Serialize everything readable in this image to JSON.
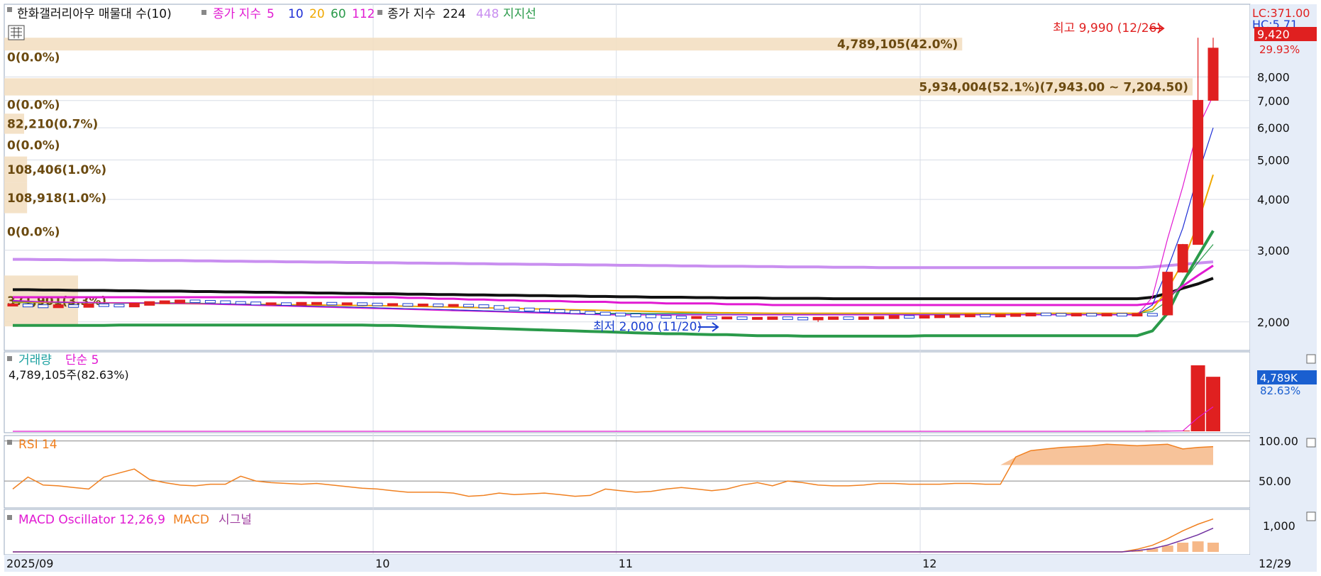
{
  "legend": {
    "title": "한화갤러리아우 매물대 수(10)",
    "ma_prefix": "종가 지수",
    "ma_periods": [
      {
        "label": "5",
        "color": "#e11ad2"
      },
      {
        "label": "10",
        "color": "#1f2fd6"
      },
      {
        "label": "20",
        "color": "#f0a800"
      },
      {
        "label": "60",
        "color": "#2a9a4a"
      },
      {
        "label": "112",
        "color": "#e11ad2"
      }
    ],
    "ma_prefix2": "종가 지수",
    "ma_224": "224",
    "ma_448": "448",
    "support_line": "지지선"
  },
  "price_panel": {
    "high_label": "최고 9,990 (12/26)",
    "low_label": "최저 2,000 (11/20)",
    "lc_label": "LC:371.00",
    "hc_label": "HC:5.71",
    "current_price": "9,420",
    "change_pct": "29.93%",
    "y_ticks": [
      "8,000",
      "7,000",
      "6,000",
      "5,000",
      "4,000",
      "3,000",
      "2,000"
    ],
    "volume_profile": [
      {
        "label": "4,789,105(42.0%)",
        "price_from": 9990,
        "price_to": 9300,
        "pct": 42.0
      },
      {
        "label": "0(0.0%)",
        "price_from": 9300,
        "price_to": 8600,
        "pct": 0.0
      },
      {
        "label": "5,934,004(52.1%)(7,943.00 ~ 7,204.50)",
        "price_from": 7943,
        "price_to": 7204.5,
        "pct": 52.1
      },
      {
        "label": "0(0.0%)",
        "price_from": 7204.5,
        "price_to": 6500,
        "pct": 0.0
      },
      {
        "label": "82,210(0.7%)",
        "price_from": 6500,
        "price_to": 5800,
        "pct": 0.7
      },
      {
        "label": "0(0.0%)",
        "price_from": 5800,
        "price_to": 5100,
        "pct": 0.0
      },
      {
        "label": "108,406(1.0%)",
        "price_from": 5100,
        "price_to": 4400,
        "pct": 1.0
      },
      {
        "label": "108,918(1.0%)",
        "price_from": 4400,
        "price_to": 3700,
        "pct": 1.0
      },
      {
        "label": "0(0.0%)",
        "price_from": 3700,
        "price_to": 3000,
        "pct": 0.0
      },
      {
        "label": "371,901(3.3%)",
        "price_from": 2600,
        "price_to": 1950,
        "pct": 3.3
      }
    ]
  },
  "volume_panel": {
    "title": "거래량",
    "ma_label": "단순 5",
    "value_label": "4,789,105주(82.63%)",
    "right_value": "4,789K",
    "right_pct": "82.63%"
  },
  "rsi_panel": {
    "title": "RSI 14",
    "ticks": [
      "100.00",
      "50.00"
    ]
  },
  "macd_panel": {
    "title": "MACD Oscillator 12,26,9",
    "macd_label": "MACD",
    "signal_label": "시그널",
    "tick": "1,000"
  },
  "x_axis": {
    "labels": [
      "2025/09",
      "10",
      "11",
      "12"
    ],
    "end_label": "12/29"
  },
  "colors": {
    "up": "#e02020",
    "down": "#1a3fd0",
    "volume_profile_bg": "#f3dfc2",
    "volume_profile_text": "#6b4a10",
    "ma224": "#111111",
    "ma448": "#c98ff0",
    "support": "#2a9a4a",
    "rsi": "#f08020",
    "axis_bg": "#e6edf8"
  },
  "chart_data": {
    "type": "candlestick",
    "title": "한화갤러리아우",
    "x": [
      "09/01",
      "09/02",
      "09/03",
      "09/04",
      "09/05",
      "09/08",
      "09/09",
      "09/10",
      "09/11",
      "09/12",
      "09/15",
      "09/16",
      "09/17",
      "09/18",
      "09/19",
      "09/22",
      "09/23",
      "09/24",
      "09/25",
      "09/26",
      "09/29",
      "09/30",
      "10/01",
      "10/02",
      "10/10",
      "10/13",
      "10/14",
      "10/15",
      "10/16",
      "10/17",
      "10/20",
      "10/21",
      "10/22",
      "10/23",
      "10/24",
      "10/27",
      "10/28",
      "10/29",
      "10/30",
      "10/31",
      "11/03",
      "11/04",
      "11/05",
      "11/06",
      "11/07",
      "11/10",
      "11/11",
      "11/12",
      "11/13",
      "11/14",
      "11/17",
      "11/18",
      "11/19",
      "11/20",
      "11/21",
      "11/24",
      "11/25",
      "11/26",
      "11/27",
      "11/28",
      "12/01",
      "12/02",
      "12/03",
      "12/04",
      "12/05",
      "12/08",
      "12/09",
      "12/10",
      "12/11",
      "12/12",
      "12/15",
      "12/16",
      "12/17",
      "12/18",
      "12/19",
      "12/22",
      "12/23",
      "12/24",
      "12/26",
      "12/29"
    ],
    "close": [
      2200,
      2190,
      2180,
      2190,
      2185,
      2200,
      2195,
      2190,
      2210,
      2230,
      2240,
      2250,
      2245,
      2240,
      2230,
      2225,
      2215,
      2215,
      2210,
      2220,
      2220,
      2215,
      2215,
      2210,
      2205,
      2205,
      2200,
      2200,
      2195,
      2195,
      2190,
      2180,
      2160,
      2150,
      2140,
      2130,
      2120,
      2110,
      2100,
      2090,
      2080,
      2070,
      2060,
      2055,
      2050,
      2050,
      2045,
      2045,
      2040,
      2040,
      2045,
      2040,
      2035,
      2040,
      2045,
      2040,
      2045,
      2050,
      2060,
      2055,
      2060,
      2065,
      2070,
      2075,
      2070,
      2075,
      2080,
      2090,
      2085,
      2080,
      2085,
      2080,
      2085,
      2080,
      2085,
      2080,
      2650,
      3100,
      7010,
      9420
    ],
    "high": 9990,
    "low": 2000,
    "high_date": "12/26",
    "low_date": "11/20",
    "ma5": [
      2260,
      2250,
      2240,
      2240,
      2235,
      2235,
      2230,
      2230,
      2230,
      2225,
      2225,
      2220,
      2215,
      2210,
      2205,
      2200,
      2195,
      2190,
      2185,
      2180,
      2175,
      2170,
      2165,
      2160,
      2155,
      2150,
      2145,
      2140,
      2135,
      2130,
      2125,
      2120,
      2115,
      2110,
      2105,
      2100,
      2095,
      2090,
      2085,
      2080,
      2080,
      2080,
      2080,
      2080,
      2080,
      2080,
      2080,
      2080,
      2080,
      2080,
      2080,
      2080,
      2080,
      2080,
      2080,
      2080,
      2080,
      2080,
      2080,
      2080,
      2080,
      2080,
      2080,
      2080,
      2080,
      2080,
      2080,
      2080,
      2080,
      2080,
      2080,
      2080,
      2080,
      2080,
      2080,
      2300,
      3200,
      4300,
      6000,
      7200
    ],
    "ma10": [
      2250,
      2245,
      2240,
      2235,
      2230,
      2230,
      2228,
      2226,
      2224,
      2222,
      2220,
      2218,
      2216,
      2214,
      2212,
      2210,
      2205,
      2200,
      2195,
      2190,
      2185,
      2180,
      2175,
      2170,
      2165,
      2160,
      2155,
      2150,
      2145,
      2140,
      2135,
      2130,
      2125,
      2120,
      2115,
      2110,
      2105,
      2100,
      2095,
      2090,
      2085,
      2085,
      2085,
      2085,
      2085,
      2085,
      2085,
      2085,
      2085,
      2085,
      2085,
      2085,
      2085,
      2085,
      2085,
      2085,
      2085,
      2085,
      2085,
      2085,
      2085,
      2085,
      2085,
      2085,
      2085,
      2085,
      2085,
      2085,
      2085,
      2085,
      2085,
      2085,
      2085,
      2085,
      2085,
      2200,
      2700,
      3400,
      4600,
      6000
    ],
    "ma20": [
      2240,
      2238,
      2236,
      2234,
      2232,
      2230,
      2228,
      2226,
      2224,
      2222,
      2220,
      2218,
      2216,
      2214,
      2212,
      2210,
      2208,
      2206,
      2204,
      2202,
      2200,
      2198,
      2196,
      2194,
      2192,
      2190,
      2186,
      2182,
      2178,
      2174,
      2170,
      2166,
      2162,
      2158,
      2154,
      2150,
      2146,
      2142,
      2138,
      2134,
      2130,
      2126,
      2122,
      2118,
      2114,
      2110,
      2108,
      2106,
      2104,
      2102,
      2100,
      2100,
      2100,
      2100,
      2100,
      2100,
      2100,
      2100,
      2100,
      2100,
      2100,
      2100,
      2100,
      2100,
      2100,
      2100,
      2100,
      2100,
      2100,
      2100,
      2100,
      2100,
      2100,
      2100,
      2100,
      2150,
      2400,
      2800,
      3500,
      4600
    ],
    "ma60": [
      2230,
      2230,
      2230,
      2230,
      2230,
      2230,
      2230,
      2230,
      2230,
      2230,
      2230,
      2230,
      2225,
      2220,
      2215,
      2210,
      2205,
      2200,
      2195,
      2190,
      2185,
      2180,
      2175,
      2170,
      2165,
      2160,
      2155,
      2150,
      2145,
      2140,
      2135,
      2130,
      2125,
      2120,
      2115,
      2110,
      2105,
      2100,
      2100,
      2100,
      2100,
      2100,
      2100,
      2100,
      2100,
      2100,
      2100,
      2100,
      2100,
      2100,
      2100,
      2100,
      2100,
      2100,
      2100,
      2100,
      2100,
      2100,
      2100,
      2100,
      2100,
      2100,
      2100,
      2100,
      2100,
      2100,
      2100,
      2100,
      2100,
      2100,
      2100,
      2100,
      2100,
      2100,
      2100,
      2120,
      2250,
      2500,
      2800,
      3100
    ],
    "ma112": [
      2300,
      2300,
      2300,
      2300,
      2300,
      2300,
      2300,
      2300,
      2300,
      2300,
      2300,
      2300,
      2300,
      2300,
      2300,
      2300,
      2300,
      2300,
      2300,
      2300,
      2300,
      2300,
      2300,
      2300,
      2300,
      2300,
      2290,
      2290,
      2280,
      2280,
      2270,
      2270,
      2260,
      2260,
      2250,
      2250,
      2250,
      2240,
      2240,
      2240,
      2230,
      2230,
      2230,
      2220,
      2220,
      2220,
      2220,
      2210,
      2210,
      2210,
      2200,
      2200,
      2200,
      2200,
      2200,
      2200,
      2200,
      2200,
      2200,
      2200,
      2200,
      2200,
      2200,
      2200,
      2200,
      2200,
      2200,
      2200,
      2200,
      2200,
      2200,
      2200,
      2200,
      2200,
      2200,
      2220,
      2300,
      2450,
      2600,
      2750
    ],
    "ma224": [
      2400,
      2400,
      2395,
      2395,
      2390,
      2390,
      2390,
      2385,
      2385,
      2380,
      2380,
      2380,
      2375,
      2375,
      2370,
      2370,
      2365,
      2365,
      2360,
      2360,
      2355,
      2355,
      2350,
      2350,
      2345,
      2345,
      2340,
      2340,
      2335,
      2335,
      2330,
      2330,
      2325,
      2325,
      2320,
      2320,
      2315,
      2315,
      2310,
      2310,
      2305,
      2305,
      2300,
      2300,
      2300,
      2295,
      2295,
      2290,
      2290,
      2290,
      2285,
      2285,
      2285,
      2285,
      2280,
      2280,
      2280,
      2280,
      2280,
      2280,
      2280,
      2280,
      2280,
      2280,
      2280,
      2280,
      2280,
      2280,
      2280,
      2280,
      2280,
      2280,
      2280,
      2280,
      2280,
      2300,
      2350,
      2420,
      2480,
      2560
    ],
    "ma448": [
      2850,
      2850,
      2845,
      2845,
      2840,
      2840,
      2840,
      2835,
      2835,
      2830,
      2830,
      2830,
      2825,
      2825,
      2820,
      2820,
      2815,
      2815,
      2810,
      2810,
      2805,
      2805,
      2800,
      2800,
      2795,
      2795,
      2790,
      2790,
      2785,
      2785,
      2780,
      2780,
      2775,
      2775,
      2770,
      2770,
      2765,
      2765,
      2760,
      2760,
      2755,
      2755,
      2750,
      2750,
      2745,
      2745,
      2740,
      2740,
      2740,
      2735,
      2735,
      2730,
      2730,
      2730,
      2725,
      2725,
      2725,
      2720,
      2720,
      2720,
      2720,
      2720,
      2720,
      2720,
      2720,
      2720,
      2720,
      2720,
      2720,
      2720,
      2720,
      2720,
      2720,
      2720,
      2720,
      2730,
      2750,
      2770,
      2790,
      2810
    ],
    "support": [
      1960,
      1960,
      1960,
      1960,
      1960,
      1960,
      1960,
      1965,
      1965,
      1965,
      1965,
      1965,
      1965,
      1965,
      1965,
      1965,
      1965,
      1965,
      1965,
      1965,
      1965,
      1965,
      1965,
      1965,
      1960,
      1960,
      1955,
      1950,
      1945,
      1940,
      1935,
      1930,
      1925,
      1920,
      1915,
      1910,
      1905,
      1900,
      1895,
      1890,
      1885,
      1880,
      1875,
      1870,
      1870,
      1865,
      1860,
      1860,
      1855,
      1850,
      1850,
      1850,
      1845,
      1845,
      1845,
      1845,
      1845,
      1845,
      1845,
      1845,
      1850,
      1850,
      1850,
      1850,
      1850,
      1850,
      1850,
      1850,
      1850,
      1850,
      1850,
      1850,
      1850,
      1850,
      1850,
      1900,
      2100,
      2500,
      2900,
      3350
    ],
    "volume_pct": [
      0,
      0,
      0,
      0,
      0,
      0,
      0,
      0,
      0,
      0,
      0,
      0,
      0,
      0,
      0,
      0,
      0,
      0,
      0,
      0,
      0,
      0,
      0,
      0,
      0,
      0,
      0,
      0,
      0,
      0,
      0,
      0,
      0,
      0,
      0,
      0,
      0,
      0,
      0,
      0,
      0,
      0,
      0,
      0,
      0,
      0,
      0,
      0,
      0,
      0,
      0,
      0,
      0,
      0,
      0,
      0,
      0,
      0,
      0,
      0,
      0,
      0,
      0,
      0,
      0,
      0,
      0,
      0,
      0,
      0,
      0,
      0,
      0,
      0,
      0,
      1,
      1,
      1,
      100,
      82.63
    ],
    "rsi": [
      40,
      55,
      45,
      44,
      42,
      40,
      55,
      60,
      65,
      52,
      48,
      45,
      44,
      46,
      46,
      56,
      50,
      48,
      47,
      46,
      47,
      45,
      43,
      41,
      40,
      38,
      36,
      36,
      36,
      35,
      31,
      32,
      35,
      33,
      34,
      35,
      33,
      31,
      32,
      40,
      38,
      36,
      37,
      40,
      42,
      40,
      38,
      40,
      45,
      48,
      44,
      50,
      48,
      45,
      44,
      44,
      45,
      47,
      47,
      46,
      46,
      46,
      47,
      47,
      46,
      46,
      80,
      88,
      90,
      92,
      93,
      94,
      96,
      95,
      94,
      95,
      96,
      90,
      92,
      93
    ],
    "macd": [
      0,
      0,
      0,
      0,
      0,
      0,
      0,
      0,
      0,
      0,
      0,
      0,
      0,
      0,
      0,
      0,
      0,
      0,
      0,
      0,
      0,
      0,
      0,
      0,
      0,
      0,
      0,
      0,
      0,
      0,
      0,
      0,
      0,
      0,
      0,
      0,
      0,
      0,
      0,
      0,
      0,
      0,
      0,
      0,
      0,
      0,
      0,
      0,
      0,
      0,
      0,
      0,
      0,
      0,
      0,
      0,
      0,
      0,
      0,
      0,
      0,
      0,
      0,
      0,
      0,
      0,
      0,
      0,
      0,
      0,
      0,
      0,
      0,
      0,
      100,
      250,
      500,
      800,
      1050,
      1250
    ],
    "macd_signal": [
      0,
      0,
      0,
      0,
      0,
      0,
      0,
      0,
      0,
      0,
      0,
      0,
      0,
      0,
      0,
      0,
      0,
      0,
      0,
      0,
      0,
      0,
      0,
      0,
      0,
      0,
      0,
      0,
      0,
      0,
      0,
      0,
      0,
      0,
      0,
      0,
      0,
      0,
      0,
      0,
      0,
      0,
      0,
      0,
      0,
      0,
      0,
      0,
      0,
      0,
      0,
      0,
      0,
      0,
      0,
      0,
      0,
      0,
      0,
      0,
      0,
      0,
      0,
      0,
      0,
      0,
      0,
      0,
      0,
      0,
      0,
      0,
      0,
      0,
      50,
      120,
      260,
      450,
      650,
      900
    ],
    "rsi_ticks": [
      100,
      50
    ],
    "macd_ticks": [
      1000
    ],
    "y_scale": "log",
    "ylim": [
      1800,
      10200
    ]
  }
}
